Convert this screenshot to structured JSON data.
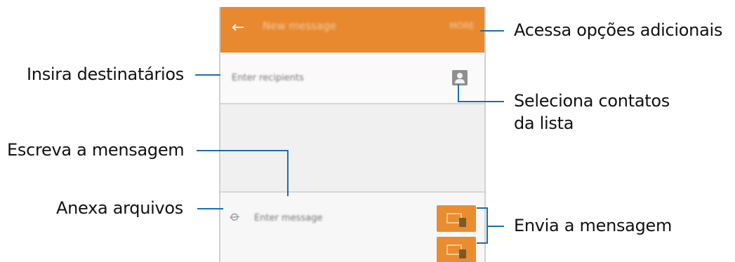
{
  "labels": {
    "more_options": "Acessa opções adicionais",
    "recipients": "Insira destinatários",
    "select_contacts_line1": "Seleciona contatos",
    "select_contacts_line2": "da lista",
    "compose_message": "Escreva a mensagem",
    "attach_files": "Anexa arquivos",
    "send_message": "Envia a mensagem"
  },
  "app": {
    "back_icon": "back-arrow-icon",
    "title": "New message",
    "more": "MORE",
    "recipient_placeholder": "Enter recipients",
    "message_placeholder": "Enter message"
  },
  "colors": {
    "accent": "#e8892f",
    "callout_line": "#1a6fb0"
  }
}
